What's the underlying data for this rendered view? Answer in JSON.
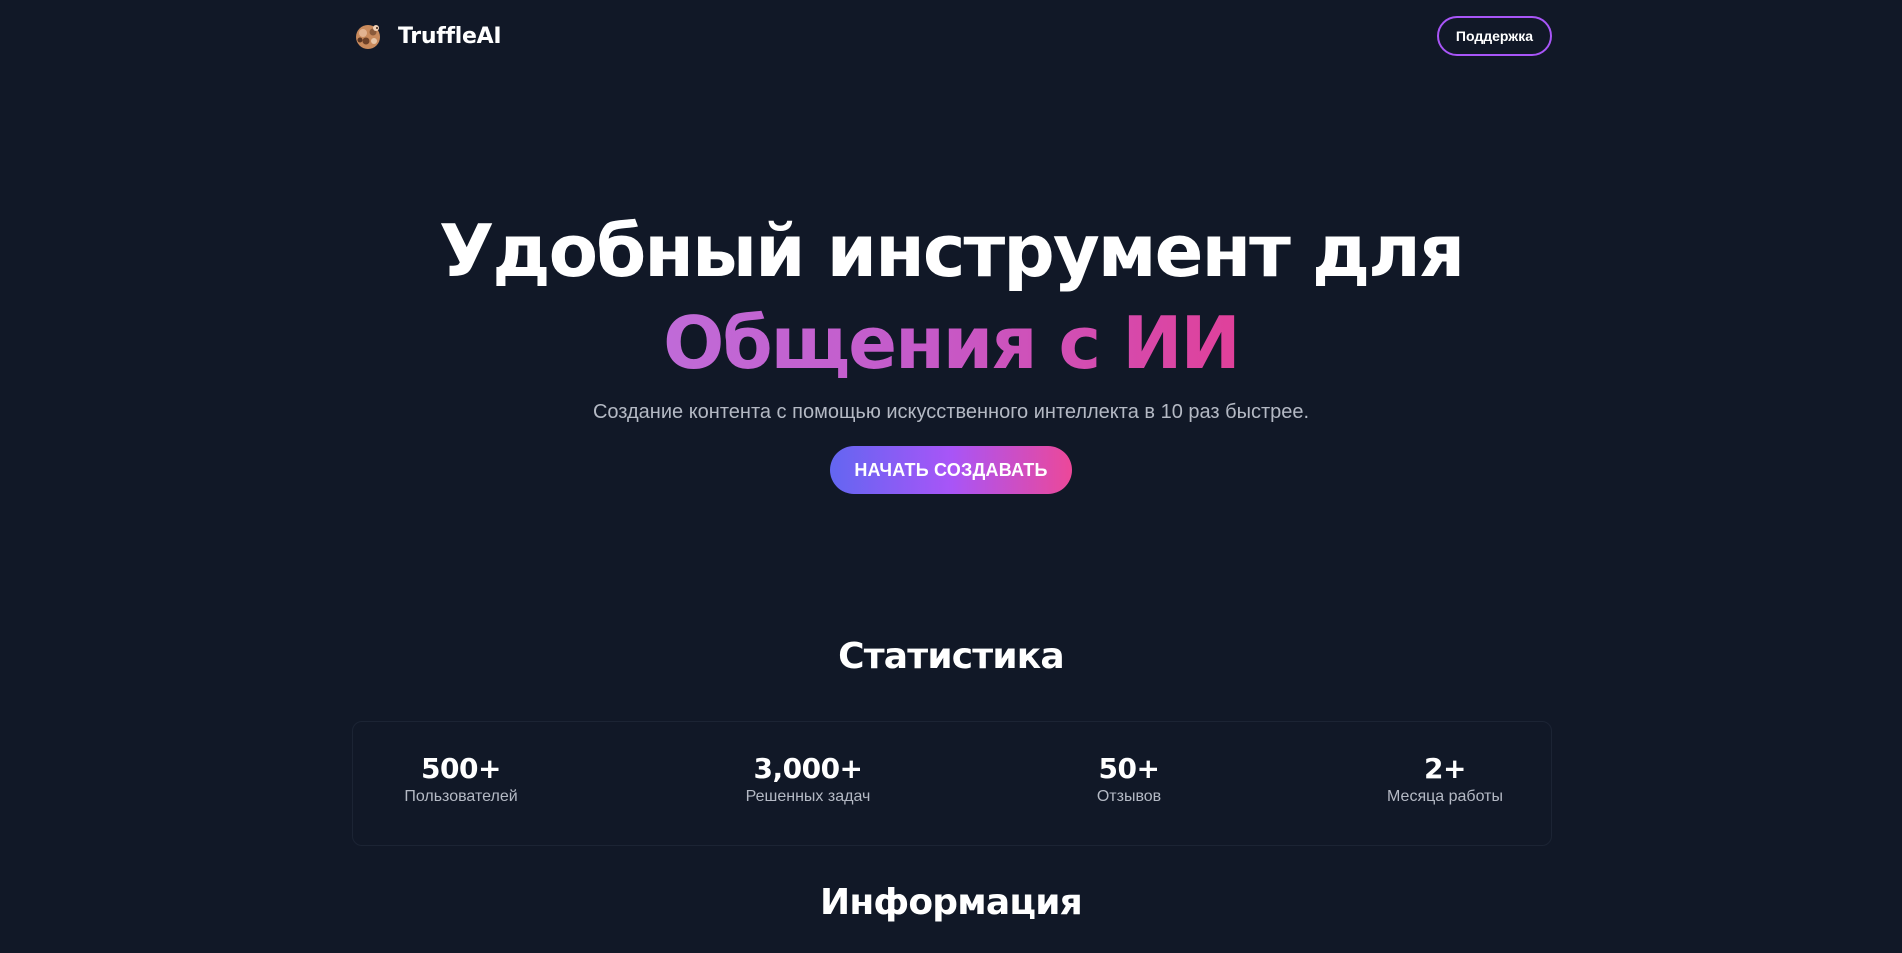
{
  "header": {
    "brand_name": "TruffleAI",
    "support_label": "Поддержка"
  },
  "hero": {
    "title_line1": "Удобный инструмент для",
    "title_line2": "Общения с ИИ",
    "subtitle": "Создание контента с помощью искусственного интеллекта в 10 раз быстрее.",
    "cta_label": "НАЧАТЬ СОЗДАВАТЬ"
  },
  "stats": {
    "title": "Статистика",
    "items": [
      {
        "value": "500+",
        "label": "Пользователей"
      },
      {
        "value": "3,000+",
        "label": "Решенных задач"
      },
      {
        "value": "50+",
        "label": "Отзывов"
      },
      {
        "value": "2+",
        "label": "Месяца работы"
      }
    ]
  },
  "info": {
    "title": "Информация"
  },
  "colors": {
    "background": "#111827",
    "accent_purple": "#a855f7",
    "accent_pink": "#ec4899",
    "accent_indigo": "#6366f1",
    "muted_text": "#b4b9c4"
  },
  "icons": {
    "logo": "truffle-pig-logo-icon"
  }
}
